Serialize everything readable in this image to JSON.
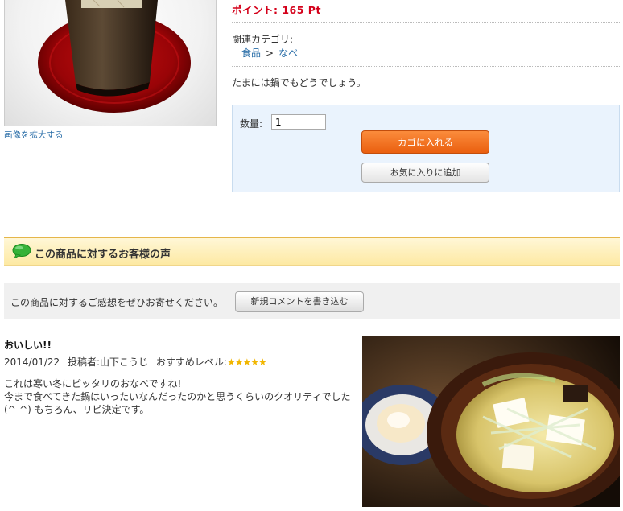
{
  "product": {
    "enlarge_link": "画像を拡大する",
    "points": "ポイント: 165 Pt",
    "category_label": "関連カテゴリ:",
    "category_crumbs": [
      "食品",
      "なべ"
    ],
    "category_separator": ">",
    "description": "たまには鍋でもどうでしょう。"
  },
  "cart": {
    "quantity_label": "数量:",
    "quantity_value": "1",
    "add_to_cart_label": "カゴに入れる",
    "add_to_favorites_label": "お気に入りに追加"
  },
  "reviews": {
    "section_title": "この商品に対するお客様の声",
    "prompt": "この商品に対するご感想をぜひお寄せください。",
    "new_comment_button": "新規コメントを書き込む",
    "items": [
      {
        "title": "おいしい!!",
        "date": "2014/01/22",
        "poster_label": "投稿者:",
        "poster": "山下こうじ",
        "rating_label": "おすすめレベル:",
        "rating": 5,
        "stars": "★★★★★",
        "body_lines": [
          "これは寒い冬にピッタリのおなべですね!",
          "今まで食べてきた鍋はいったいなんだったのかと思うくらいのクオリティでした",
          "(^-^) もちろん、リピ決定です。"
        ]
      }
    ]
  },
  "colors": {
    "accent_orange": "#ea5f0f",
    "points_red": "#d4001a",
    "link_blue": "#2a6ea8",
    "star_gold": "#f1b600"
  }
}
